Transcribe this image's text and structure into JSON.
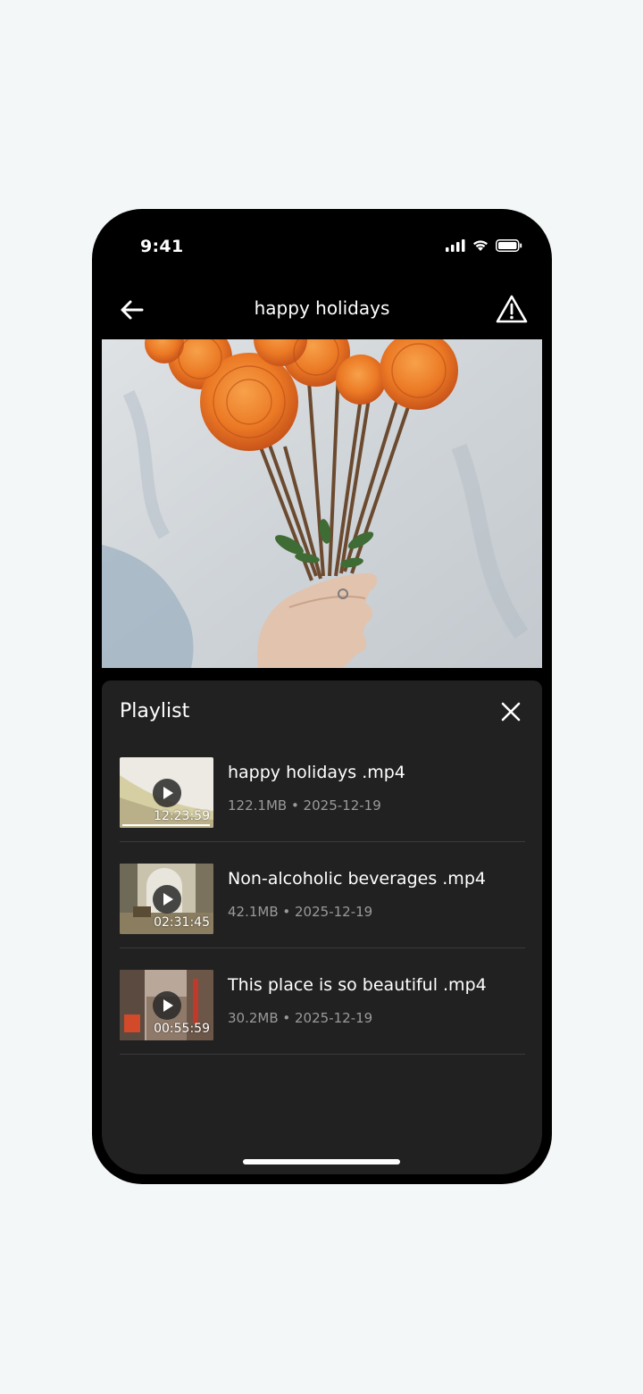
{
  "status_bar": {
    "time": "9:41",
    "icons": [
      "signal-icon",
      "wifi-icon",
      "battery-icon"
    ]
  },
  "header": {
    "title": "happy holidays",
    "back_icon": "arrow-left-icon",
    "report_icon": "warning-triangle-icon"
  },
  "video": {
    "description_icon": "video-frame"
  },
  "playlist": {
    "title": "Playlist",
    "close_icon": "close-icon",
    "items": [
      {
        "name": "happy holidays .mp4",
        "meta": "122.1MB • 2025-12-19",
        "duration": "12:23:59",
        "progress": 0.98
      },
      {
        "name": "Non-alcoholic beverages .mp4",
        "meta": "42.1MB • 2025-12-19",
        "duration": "02:31:45"
      },
      {
        "name": "This place is so beautiful .mp4",
        "meta": "30.2MB • 2025-12-19",
        "duration": "00:55:59"
      }
    ]
  },
  "colors": {
    "background": "#f4f7f8",
    "frame": "#000000",
    "panel": "#212121",
    "meta_text": "#9a9a9a"
  }
}
